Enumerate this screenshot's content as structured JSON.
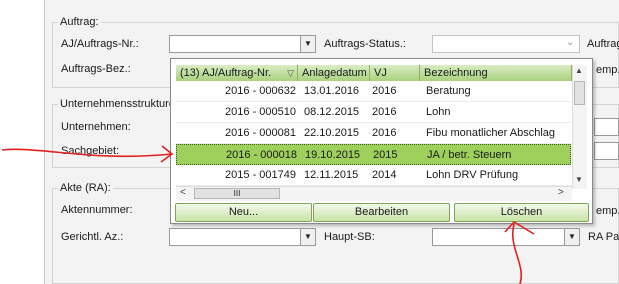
{
  "form": {
    "group_auftrag": "Auftrag:",
    "lbl_aj_auftrags_nr": "AJ/Auftrags-Nr.:",
    "lbl_auftrags_status": "Auftrags-Status.:",
    "lbl_auftrag_right": "Auftrag",
    "lbl_auftrags_bez": "Auftrags-Bez.:",
    "lbl_temp_1": "emp.",
    "group_unternehmen": "Unternehmensstrukture",
    "lbl_unternehmen": "Unternehmen:",
    "lbl_sachgebiet": "Sachgebiet:",
    "group_akte": "Akte (RA):",
    "lbl_aktennummer": "Aktennummer:",
    "lbl_temp_2": "emp.",
    "lbl_gerichtl_az": "Gerichtl. Az.:",
    "lbl_haupt_sb": "Haupt-SB:",
    "lbl_ra_pa": "RA Pa"
  },
  "popup": {
    "columns": [
      "(13) AJ/Auftrag-Nr.",
      "Anlagedatum",
      "VJ",
      "Bezeichnung"
    ],
    "rows": [
      {
        "nr": "2016 - 000632",
        "datum": "13.01.2016",
        "vj": "2016",
        "bez": "Beratung"
      },
      {
        "nr": "2016 - 000510",
        "datum": "08.12.2015",
        "vj": "2016",
        "bez": "Lohn"
      },
      {
        "nr": "2016 - 000081",
        "datum": "22.10.2015",
        "vj": "2016",
        "bez": "Fibu monatlicher Abschlag"
      },
      {
        "nr": "2016 - 000018",
        "datum": "19.10.2015",
        "vj": "2015",
        "bez": "JA / betr. Steuern"
      },
      {
        "nr": "2015 - 001749",
        "datum": "12.11.2015",
        "vj": "2014",
        "bez": "Lohn DRV Prüfung"
      }
    ],
    "selected_row": 3,
    "scroll_thumb_glyph": "III",
    "buttons": {
      "neu": "Neu...",
      "bearbeiten": "Bearbeiten",
      "loeschen": "Löschen"
    }
  },
  "colors": {
    "selected_row": "#9fd05c",
    "header_green": "#a9d27e",
    "annotation_red": "#e02020"
  }
}
